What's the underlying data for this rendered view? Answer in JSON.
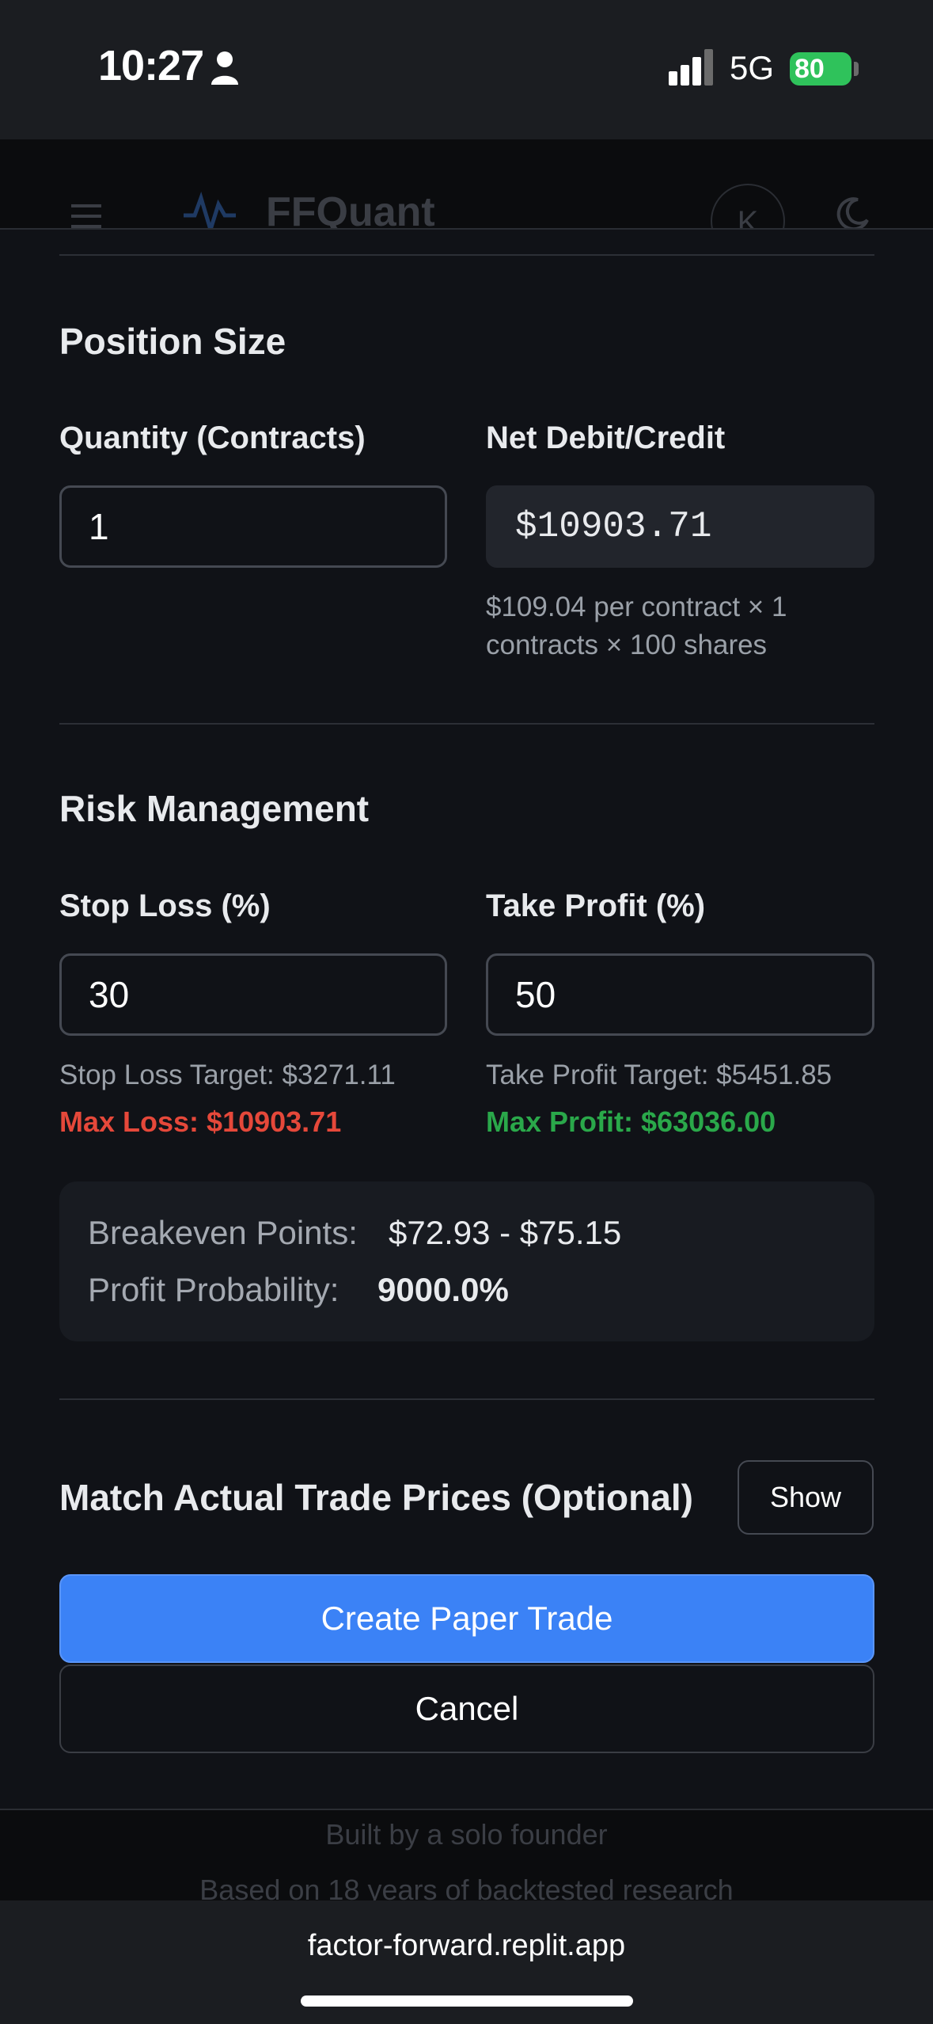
{
  "status_bar": {
    "time": "10:27",
    "network": "5G",
    "battery": "80"
  },
  "background": {
    "brand": "FFQuant",
    "avatar_initial": "K",
    "footer_line1": "Built by a solo founder",
    "footer_line2": "Based on 18 years of backtested research"
  },
  "position_size": {
    "title": "Position Size",
    "quantity_label": "Quantity (Contracts)",
    "quantity_value": "1",
    "net_label": "Net Debit/Credit",
    "net_value": "$10903.71",
    "net_help_line1": "$109.04 per contract × 1",
    "net_help_line2": "contracts × 100 shares"
  },
  "risk_management": {
    "title": "Risk Management",
    "stop_loss_label": "Stop Loss (%)",
    "stop_loss_value": "30",
    "take_profit_label": "Take Profit (%)",
    "take_profit_value": "50",
    "stop_loss_target": "Stop Loss Target: $3271.11",
    "max_loss": "Max Loss: $10903.71",
    "take_profit_target": "Take Profit Target: $5451.85",
    "max_profit": "Max Profit: $63036.00"
  },
  "summary": {
    "breakeven_label": "Breakeven Points:",
    "breakeven_value": "$72.93 - $75.15",
    "probability_label": "Profit Probability:",
    "probability_value": "9000.0%"
  },
  "match_prices": {
    "title": "Match Actual Trade Prices (Optional)",
    "show_label": "Show"
  },
  "actions": {
    "create_label": "Create Paper Trade",
    "cancel_label": "Cancel"
  },
  "browser": {
    "url": "factor-forward.replit.app"
  },
  "colors": {
    "accent": "#3b82f6",
    "loss": "#e5483a",
    "profit": "#2aa84a",
    "battery": "#2fc25b"
  }
}
